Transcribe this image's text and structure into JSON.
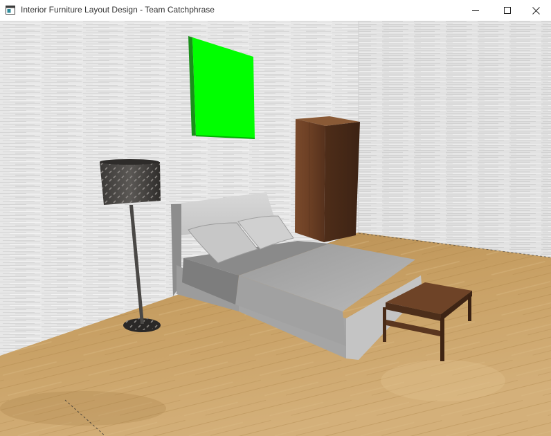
{
  "window": {
    "title": "Interior Furniture Layout Design - Team Catchphrase",
    "app_icon": "window-app-icon",
    "controls": {
      "minimize_icon": "minimize-icon",
      "maximize_icon": "maximize-icon",
      "close_icon": "close-icon"
    }
  },
  "scene": {
    "objects": [
      "wall-painting",
      "floor-lamp",
      "wardrobe",
      "bed",
      "coffee-table"
    ],
    "colors": {
      "painting": "#00ff00",
      "wall": "#e6e6e6",
      "floor": "#c29a5d",
      "wood": "#6b4228",
      "bed": "#b0b0b0",
      "lampshade": "#4a4846"
    }
  }
}
